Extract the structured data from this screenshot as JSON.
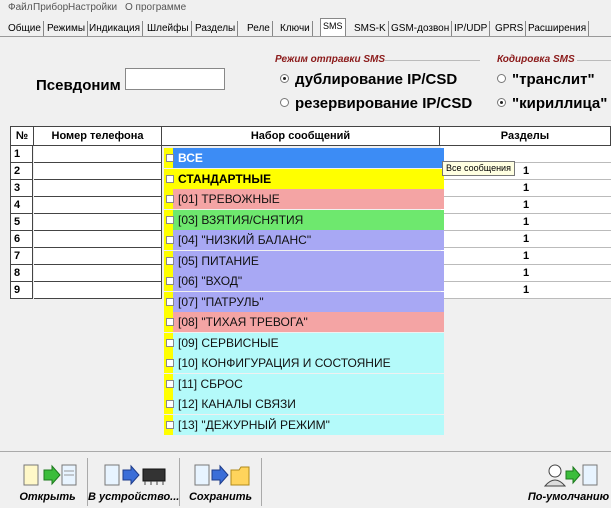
{
  "menu": [
    "Файл",
    "Прибор",
    "Настройки",
    "О программе"
  ],
  "tabs": [
    {
      "label": "Общие",
      "active": false
    },
    {
      "label": "Режимы",
      "active": false
    },
    {
      "label": "Индикация",
      "active": false
    },
    {
      "label": "Шлейфы",
      "active": false
    },
    {
      "label": "Разделы",
      "active": false
    },
    {
      "label": "Реле",
      "active": false
    },
    {
      "label": "Ключи",
      "active": false
    },
    {
      "label": "SMS",
      "active": true
    },
    {
      "label": "SMS-K",
      "active": false
    },
    {
      "label": "GSM-дозвон",
      "active": false
    },
    {
      "label": "IP/UDP",
      "active": false
    },
    {
      "label": "GPRS",
      "active": false
    },
    {
      "label": "Расширения",
      "active": false
    }
  ],
  "alias": {
    "label": "Псевдоним :",
    "value": ""
  },
  "send_mode": {
    "title": "Режим отправки SMS",
    "options": [
      {
        "label": "дублирование IP/CSD",
        "checked": true
      },
      {
        "label": "резервирование IP/CSD",
        "checked": false
      }
    ]
  },
  "encoding": {
    "title": "Кодировка SMS",
    "options": [
      {
        "label": "\"транслит\"",
        "checked": false
      },
      {
        "label": "\"кириллица\"",
        "checked": true
      }
    ]
  },
  "table": {
    "headers": {
      "num": "№",
      "phone": "Номер телефона",
      "messages": "Набор сообщений",
      "sections": "Разделы"
    },
    "rows": [
      {
        "num": "1",
        "phone": "",
        "sections": ""
      },
      {
        "num": "2",
        "phone": "",
        "sections": "1"
      },
      {
        "num": "3",
        "phone": "",
        "sections": "1"
      },
      {
        "num": "4",
        "phone": "",
        "sections": "1"
      },
      {
        "num": "5",
        "phone": "",
        "sections": "1"
      },
      {
        "num": "6",
        "phone": "",
        "sections": "1"
      },
      {
        "num": "7",
        "phone": "",
        "sections": "1"
      },
      {
        "num": "8",
        "phone": "",
        "sections": "1"
      },
      {
        "num": "9",
        "phone": "",
        "sections": "1"
      }
    ]
  },
  "message_list": {
    "items": [
      {
        "label": "ВСЕ",
        "bg": "#3c8cf5",
        "color": "#ffffff",
        "bold": true,
        "checked": false
      },
      {
        "label": "СТАНДАРТНЫЕ",
        "bg": "#ffff00",
        "color": "#000000",
        "bold": true,
        "checked": false
      },
      {
        "label": "[01] ТРЕВОЖНЫЕ",
        "bg": "#f4a4a4",
        "color": "#111111",
        "bold": false,
        "checked": false
      },
      {
        "label": "[03] ВЗЯТИЯ/СНЯТИЯ",
        "bg": "#6ee86e",
        "color": "#111111",
        "bold": false,
        "checked": false
      },
      {
        "label": "[04] \"НИЗКИЙ БАЛАНС\"",
        "bg": "#a8a8f4",
        "color": "#111111",
        "bold": false,
        "checked": false
      },
      {
        "label": "[05] ПИТАНИЕ",
        "bg": "#a8a8f4",
        "color": "#111111",
        "bold": false,
        "checked": false
      },
      {
        "label": "[06] \"ВХОД\"",
        "bg": "#a8a8f4",
        "color": "#111111",
        "bold": false,
        "checked": false
      },
      {
        "label": "[07] \"ПАТРУЛЬ\"",
        "bg": "#a8a8f4",
        "color": "#111111",
        "bold": false,
        "checked": false
      },
      {
        "label": "[08] \"ТИХАЯ ТРЕВОГА\"",
        "bg": "#f4a4a4",
        "color": "#111111",
        "bold": false,
        "checked": false
      },
      {
        "label": "[09] СЕРВИСНЫЕ",
        "bg": "#b4fafa",
        "color": "#111111",
        "bold": false,
        "checked": false
      },
      {
        "label": "[10] КОНФИГУРАЦИЯ И СОСТОЯНИЕ",
        "bg": "#b4fafa",
        "color": "#111111",
        "bold": false,
        "checked": false
      },
      {
        "label": "[11] СБРОС",
        "bg": "#b4fafa",
        "color": "#111111",
        "bold": false,
        "checked": false
      },
      {
        "label": "[12] КАНАЛЫ СВЯЗИ",
        "bg": "#b4fafa",
        "color": "#111111",
        "bold": false,
        "checked": false
      },
      {
        "label": "[13] \"ДЕЖУРНЫЙ РЕЖИМ\"",
        "bg": "#b4fafa",
        "color": "#111111",
        "bold": false,
        "checked": false
      }
    ],
    "tooltip": "Все сообщения"
  },
  "toolbar": [
    {
      "label": "Открыть",
      "icon": "open-file-icon"
    },
    {
      "label": "В устройство...",
      "icon": "write-to-device-icon"
    },
    {
      "label": "Сохранить",
      "icon": "save-to-folder-icon"
    },
    {
      "label": "По-умолчанию",
      "icon": "defaults-icon"
    }
  ]
}
